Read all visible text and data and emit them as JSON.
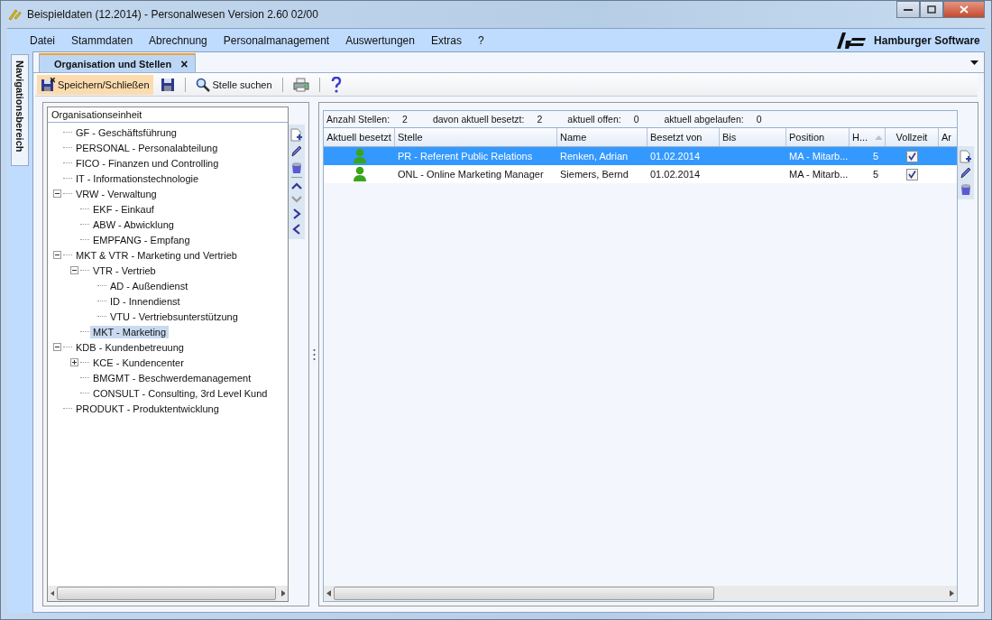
{
  "window": {
    "title": "Beispieldaten (12.2014) - Personalwesen Version 2.60 02/00"
  },
  "menu": [
    "Datei",
    "Stammdaten",
    "Abrechnung",
    "Personalmanagement",
    "Auswertungen",
    "Extras",
    "?"
  ],
  "brand": "Hamburger Software",
  "side_tab": "Navigationsbereich",
  "tabs": [
    {
      "label": "Organisation und Stellen",
      "selected": true,
      "close": "×"
    }
  ],
  "toolbar": {
    "save_close": "Speichern/Schließen",
    "search": "Stelle suchen"
  },
  "tree": {
    "header": "Organisationseinheit",
    "items": [
      {
        "label": "GF - Geschäftsführung",
        "selected": false
      },
      {
        "label": "PERSONAL - Personalabteilung",
        "selected": false
      },
      {
        "label": "FICO - Finanzen und Controlling",
        "selected": false
      },
      {
        "label": "IT - Informationstechnologie",
        "selected": false
      },
      {
        "label": "VRW - Verwaltung",
        "selected": false,
        "expanded": true,
        "children": [
          {
            "label": "EKF - Einkauf",
            "selected": false
          },
          {
            "label": "ABW - Abwicklung",
            "selected": false
          },
          {
            "label": "EMPFANG - Empfang",
            "selected": false
          }
        ]
      },
      {
        "label": "MKT & VTR - Marketing und Vertrieb",
        "selected": false,
        "expanded": true,
        "children": [
          {
            "label": "VTR - Vertrieb",
            "selected": false,
            "expanded": true,
            "children": [
              {
                "label": "AD - Außendienst",
                "selected": false
              },
              {
                "label": "ID - Innendienst",
                "selected": false
              },
              {
                "label": "VTU - Vertriebsunterstützung",
                "selected": false
              }
            ]
          },
          {
            "label": "MKT - Marketing",
            "selected": true
          }
        ]
      },
      {
        "label": "KDB - Kundenbetreuung",
        "selected": false,
        "expanded": true,
        "children": [
          {
            "label": "KCE - Kundencenter",
            "selected": false,
            "expanded": false
          },
          {
            "label": "BMGMT - Beschwerdemanagement",
            "selected": false
          },
          {
            "label": "CONSULT - Consulting, 3rd Level Kund",
            "selected": false
          }
        ]
      },
      {
        "label": "PRODUKT - Produktentwicklung",
        "selected": false
      }
    ]
  },
  "summary": [
    {
      "label": "Anzahl Stellen:",
      "value": "2"
    },
    {
      "label": "davon aktuell besetzt:",
      "value": "2"
    },
    {
      "label": "aktuell offen:",
      "value": "0"
    },
    {
      "label": "aktuell abgelaufen:",
      "value": "0"
    }
  ],
  "table": {
    "columns": [
      "Aktuell besetzt",
      "Stelle",
      "Name",
      "Besetzt von",
      "Bis",
      "Position",
      "H...",
      "Vollzeit",
      "Ar"
    ],
    "rows": [
      {
        "selected": true,
        "occupied": true,
        "stelle": "PR - Referent Public Relations",
        "name": "Renken, Adrian",
        "von": "01.02.2014",
        "position": "MA - Mitarb...",
        "h": "5",
        "vollzeit": true
      },
      {
        "selected": false,
        "occupied": true,
        "stelle": "ONL - Online Marketing Manager",
        "name": "Siemers, Bernd",
        "von": "01.02.2014",
        "position": "MA - Mitarb...",
        "h": "5",
        "vollzeit": true
      }
    ]
  }
}
